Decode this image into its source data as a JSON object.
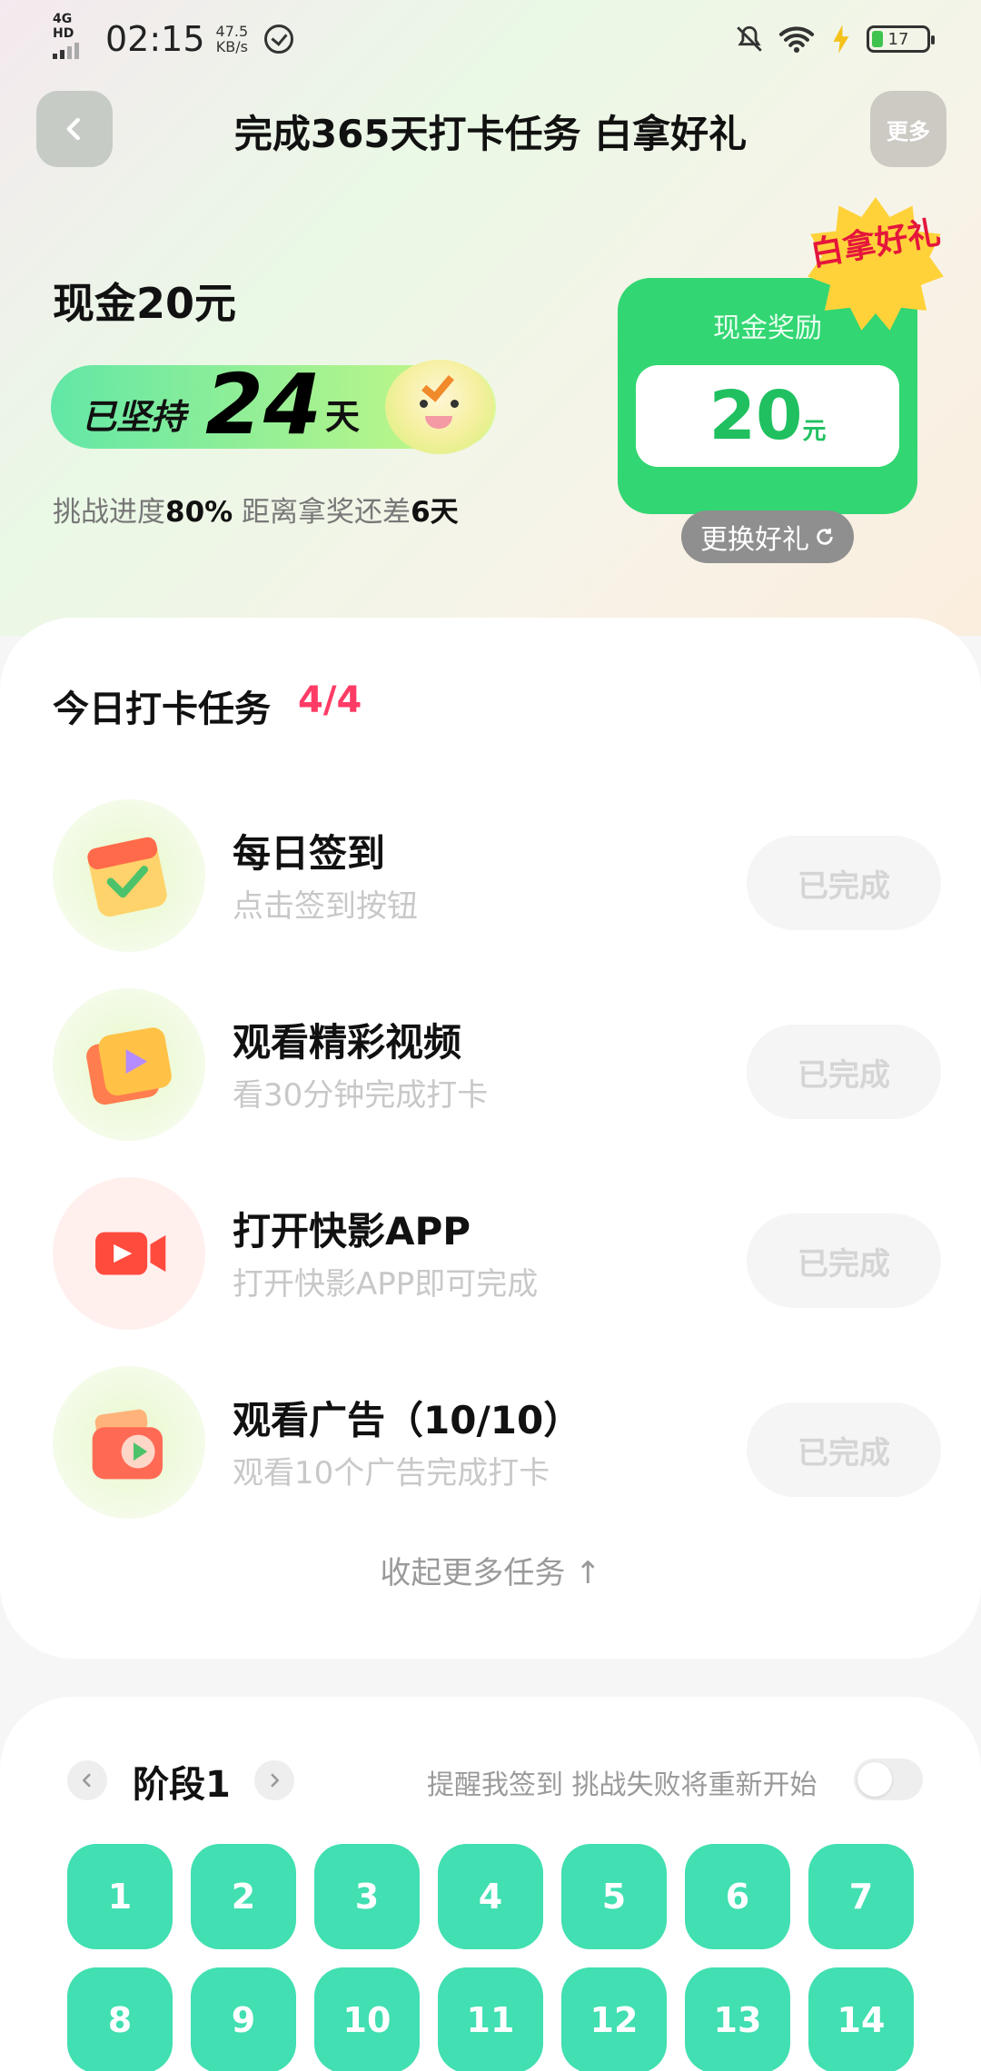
{
  "status_bar": {
    "network": "4G HD",
    "time": "02:15",
    "speed_value": "47.5",
    "speed_unit": "KB/s",
    "battery": "17"
  },
  "header": {
    "back_icon": "chevron-left-icon",
    "title": "完成365天打卡任务 白拿好礼",
    "more_label": "更多"
  },
  "goal": {
    "title": "现金20元",
    "streak_prefix": "已坚持",
    "streak_days": "24",
    "streak_suffix": "天",
    "progress_prefix": "挑战进度",
    "progress_value": "80%",
    "progress_middle": "距离拿奖还差",
    "progress_remaining": "6天"
  },
  "reward": {
    "label": "现金奖励",
    "amount": "20",
    "unit": "元",
    "badge": "白拿好礼",
    "swap_label": "更换好礼",
    "swap_icon": "refresh-icon",
    "accent": "#32d672",
    "badge_color": "#ffd23a"
  },
  "tasks": {
    "header": "今日打卡任务",
    "count": "4/4",
    "count_color": "#ff3b66",
    "items": [
      {
        "title": "每日签到",
        "subtitle": "点击签到按钮",
        "button": "已完成",
        "icon": "calendar-check-icon"
      },
      {
        "title": "观看精彩视频",
        "subtitle": "看30分钟完成打卡",
        "button": "已完成",
        "icon": "video-play-icon"
      },
      {
        "title": "打开快影APP",
        "subtitle": "打开快影APP即可完成",
        "button": "已完成",
        "icon": "video-camera-icon"
      },
      {
        "title": "观看广告（10/10）",
        "subtitle": "观看10个广告完成打卡",
        "button": "已完成",
        "icon": "ad-gift-icon"
      }
    ],
    "collapse_label": "收起更多任务 ↑"
  },
  "stage": {
    "prev_icon": "chevron-left-icon",
    "label": "阶段1",
    "next_icon": "chevron-right-icon",
    "remind_text": "提醒我签到 挑战失败将重新开始",
    "toggle_on": false,
    "days": [
      "1",
      "2",
      "3",
      "4",
      "5",
      "6",
      "7",
      "8",
      "9",
      "10",
      "11",
      "12",
      "13",
      "14"
    ],
    "day_color": "#41dfb1"
  }
}
